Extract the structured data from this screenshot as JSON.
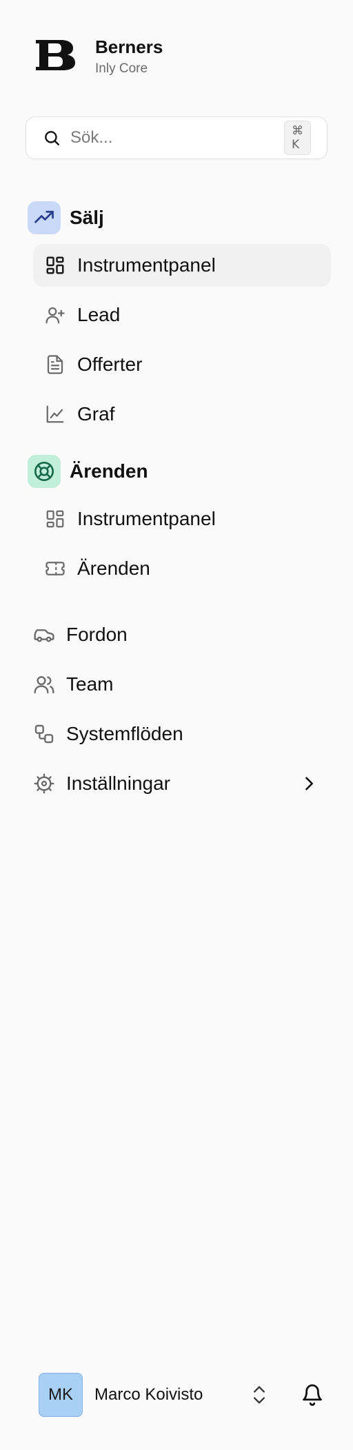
{
  "brand": {
    "name": "Berners",
    "subtitle": "Inly Core"
  },
  "search": {
    "placeholder": "Sök...",
    "shortcut": "⌘ K"
  },
  "sections": [
    {
      "title": "Sälj",
      "icon": "trending-up-icon",
      "badge_color": "#c9d9f7",
      "items": [
        {
          "label": "Instrumentpanel",
          "icon": "dashboard-icon",
          "active": true
        },
        {
          "label": "Lead",
          "icon": "user-plus-icon"
        },
        {
          "label": "Offerter",
          "icon": "file-text-icon"
        },
        {
          "label": "Graf",
          "icon": "line-chart-icon"
        }
      ]
    },
    {
      "title": "Ärenden",
      "icon": "life-buoy-icon",
      "badge_color": "#c2efd9",
      "items": [
        {
          "label": "Instrumentpanel",
          "icon": "dashboard-icon"
        },
        {
          "label": "Ärenden",
          "icon": "ticket-icon"
        }
      ]
    }
  ],
  "nav": [
    {
      "label": "Fordon",
      "icon": "car-icon"
    },
    {
      "label": "Team",
      "icon": "users-icon"
    },
    {
      "label": "Systemflöden",
      "icon": "workflow-icon"
    },
    {
      "label": "Inställningar",
      "icon": "cog-icon"
    }
  ],
  "user": {
    "initials": "MK",
    "name": "Marco Koivisto",
    "avatar_color": "#a8d0f5"
  },
  "colors": {
    "background": "#fafafa",
    "active_item": "#f1f1f1",
    "icon": "#6b6b6b"
  }
}
